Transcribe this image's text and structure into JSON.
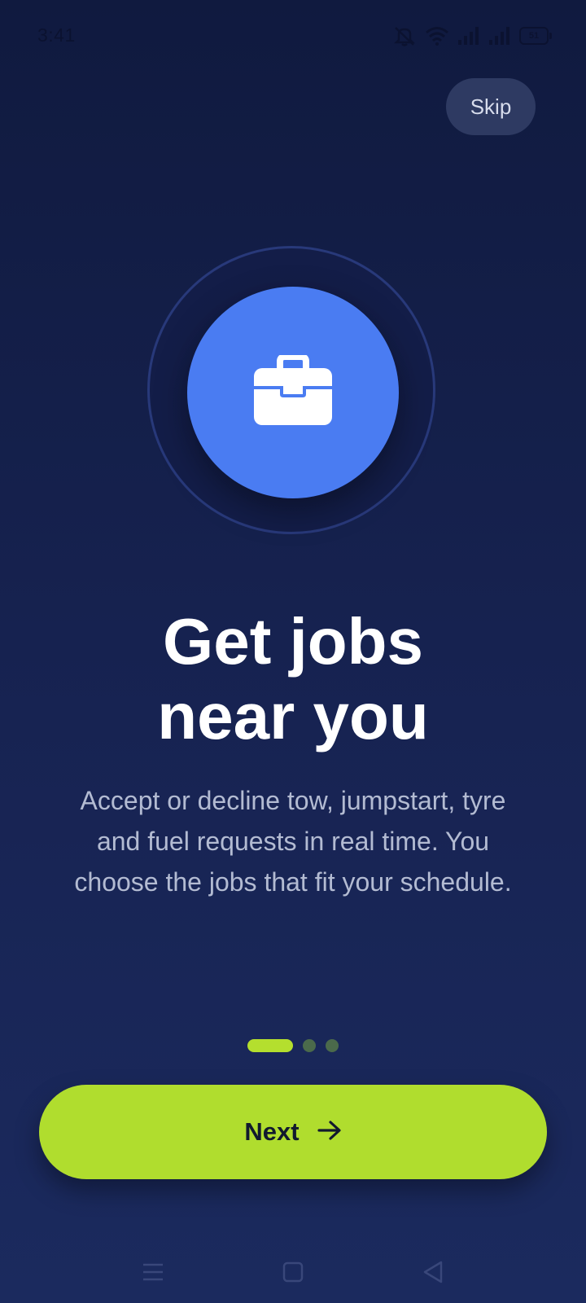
{
  "status_bar": {
    "time": "3:41",
    "battery": "51",
    "icons": [
      "mute-icon",
      "wifi-icon",
      "signal-icon",
      "signal-icon",
      "battery-icon"
    ]
  },
  "skip_label": "Skip",
  "hero": {
    "icon": "briefcase-icon"
  },
  "title_line1": "Get jobs",
  "title_line2": "near you",
  "subtitle": "Accept or decline tow, jumpstart, tyre and fuel requests in real time. You choose the jobs that fit your schedule.",
  "pager": {
    "current": 1,
    "total": 3
  },
  "next_label": "Next",
  "nav_bar": {
    "icons": [
      "menu-icon",
      "home-icon",
      "back-icon"
    ]
  },
  "colors": {
    "background": "#172352",
    "accent": "#b0dd2e",
    "hero_circle": "#4a7cf2",
    "skip_bg": "#2e3a62"
  }
}
